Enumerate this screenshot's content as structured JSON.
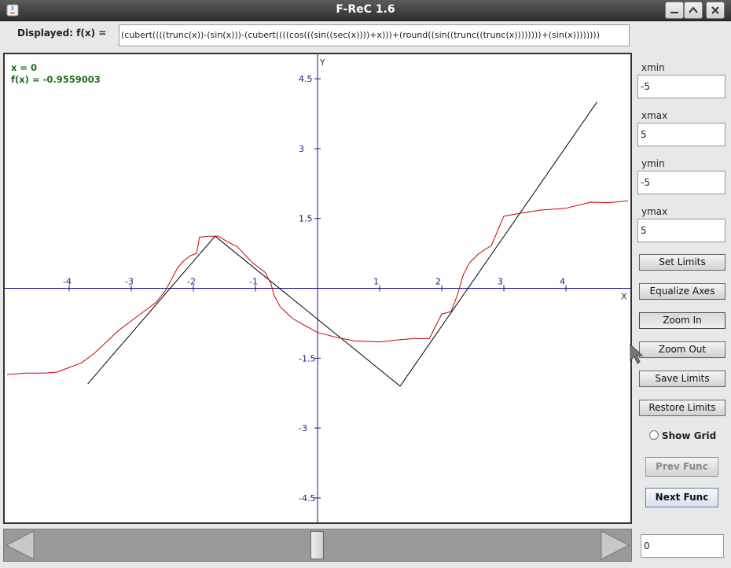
{
  "window": {
    "title": "F-ReC 1.6"
  },
  "header": {
    "displayed_label": "Displayed: f(x) =",
    "function_text": "(cubert((((trunc(x))-(sin(x)))-(cubert((((cos(((sin((sec(x))))+x)))+(round((sin((trunc((trunc(x))))))))+(sin(x))))))))"
  },
  "readout": {
    "x_text": "x = 0",
    "fx_text": "f(x) = -0.9559003"
  },
  "limits": {
    "xmin_label": "xmin",
    "xmin_value": "-5",
    "xmax_label": "xmax",
    "xmax_value": "5",
    "ymin_label": "ymin",
    "ymin_value": "-5",
    "ymax_label": "ymax",
    "ymax_value": "5"
  },
  "buttons": {
    "set_limits": "Set Limits",
    "equalize_axes": "Equalize  Axes",
    "zoom_in": "Zoom  In",
    "zoom_out": "Zoom Out",
    "save_limits": "Save  Limits",
    "restore_limits": "Restore Limits",
    "show_grid": "Show Grid",
    "prev_func": "Prev Func",
    "next_func": "Next Func"
  },
  "step_value": "0",
  "chart_data": {
    "type": "line",
    "xlim": [
      -5,
      5
    ],
    "ylim": [
      -5,
      5
    ],
    "xlabel": "X",
    "ylabel": "Y",
    "x_ticks": [
      "-4",
      "-3",
      "-2",
      "-1",
      "1",
      "2",
      "3",
      "4"
    ],
    "y_ticks": [
      "4.5",
      "3",
      "1.5",
      "-1.5",
      "-3",
      "-4.5"
    ],
    "grid": false,
    "colors": {
      "axis": "#1a1a8c",
      "target": "#000000",
      "candidate": "#cc0000",
      "readout": "#1f6b1f"
    },
    "series": [
      {
        "color": "#000000",
        "x": [
          -3.7,
          -1.65,
          1.33,
          4.5
        ],
        "y": [
          -2.05,
          1.12,
          -2.1,
          4.0
        ]
      },
      {
        "color": "#cc0000",
        "x": [
          -5.0,
          -4.7,
          -4.4,
          -4.2,
          -4.0,
          -3.8,
          -3.6,
          -3.4,
          -3.2,
          -3.0,
          -2.8,
          -2.6,
          -2.45,
          -2.35,
          -2.25,
          -2.15,
          -2.05,
          -1.95,
          -1.9,
          -1.75,
          -1.6,
          -1.45,
          -1.3,
          -1.05,
          -0.85,
          -0.75,
          -0.7,
          -0.6,
          -0.4,
          -0.2,
          0.0,
          0.3,
          0.6,
          1.0,
          1.35,
          1.55,
          1.8,
          2.0,
          2.15,
          2.25,
          2.35,
          2.45,
          2.6,
          2.8,
          3.0,
          3.3,
          3.6,
          4.0,
          4.4,
          4.7,
          5.0
        ],
        "y": [
          -1.85,
          -1.82,
          -1.82,
          -1.8,
          -1.7,
          -1.6,
          -1.4,
          -1.15,
          -0.9,
          -0.7,
          -0.5,
          -0.3,
          -0.05,
          0.2,
          0.45,
          0.6,
          0.7,
          0.75,
          1.1,
          1.12,
          1.12,
          1.0,
          0.9,
          0.55,
          0.35,
          0.1,
          -0.15,
          -0.4,
          -0.65,
          -0.8,
          -0.95,
          -1.05,
          -1.13,
          -1.15,
          -1.1,
          -1.08,
          -1.08,
          -0.55,
          -0.5,
          -0.15,
          0.3,
          0.55,
          0.75,
          0.92,
          1.55,
          1.62,
          1.68,
          1.72,
          1.85,
          1.84,
          1.88
        ]
      }
    ]
  }
}
